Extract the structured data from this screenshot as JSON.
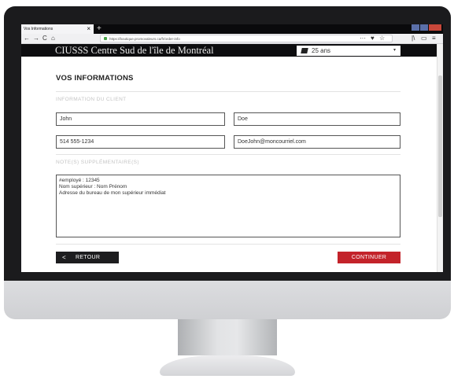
{
  "browser": {
    "tab_title": "Vos Informations",
    "tab_close": "×",
    "new_tab": "+",
    "url": "https://boutique.promovaleurs.ca/fr/order-info",
    "icons": {
      "back": "←",
      "forward": "→",
      "reload": "C",
      "home": "⌂",
      "more": "···",
      "pocket": "♥",
      "bookmark": "☆",
      "library": "|\\",
      "sidebar": "▭",
      "menu": "≡"
    }
  },
  "header": {
    "brand": "CIUSSS Centre Sud de l'île de Montréal",
    "age_select": "25 ans",
    "caret": "▾"
  },
  "form": {
    "title": "VOS INFORMATIONS",
    "section_client": "INFORMATION DU CLIENT",
    "first_name": "John",
    "last_name": "Doe",
    "phone": "514 555-1234",
    "email": "DoeJohn@moncourriel.com",
    "section_notes": "NOTE(S) SUPPLÉMENTAIRE(S)",
    "notes": [
      "#employé : 12345",
      "Nom supérieur : Nom Prénom",
      "Adresse du bureau de mon supérieur immédiat"
    ]
  },
  "actions": {
    "back_chevron": "<",
    "back_label": "RETOUR",
    "next_label": "CONTINUER"
  },
  "colors": {
    "accent_red": "#c3232a",
    "dark": "#1d1d1f"
  }
}
